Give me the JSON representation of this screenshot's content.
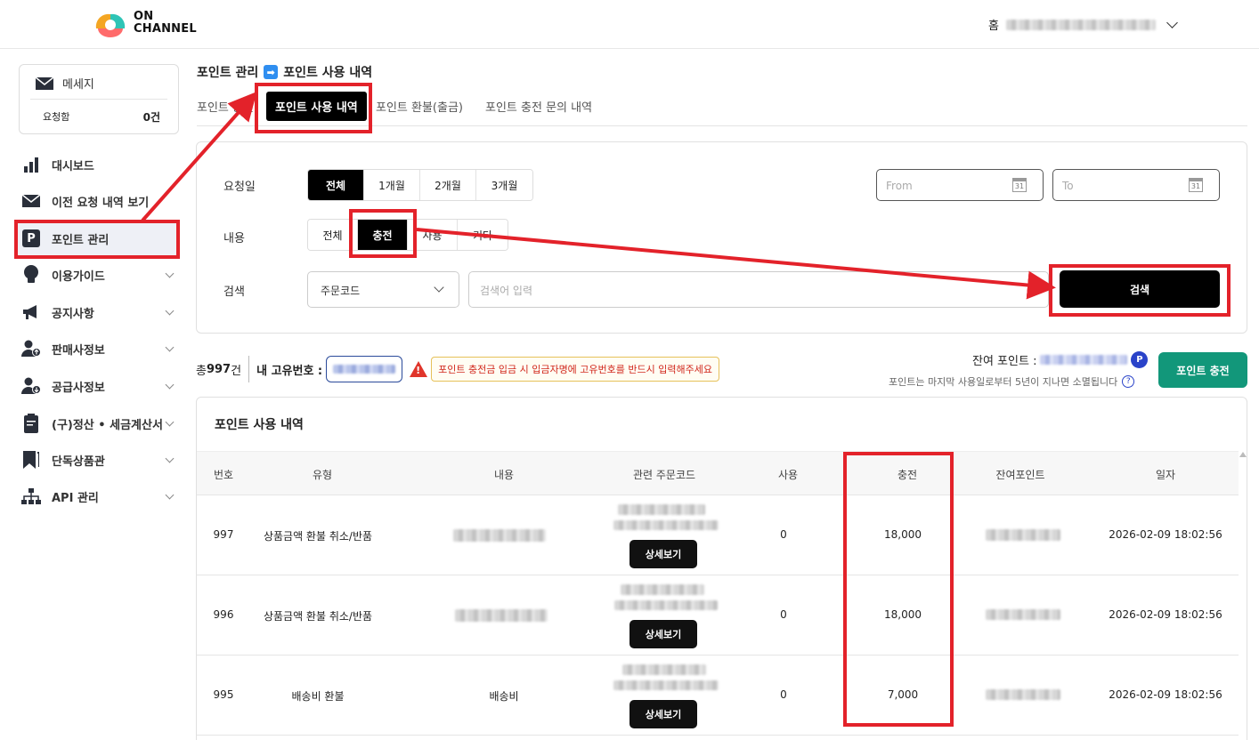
{
  "header": {
    "logo_line1": "ON",
    "logo_line2": "CHANNEL",
    "home_label": "홈"
  },
  "sidebar": {
    "message": {
      "title": "메세지",
      "request_label": "요청함",
      "request_count": "0건"
    },
    "items": [
      {
        "label": "대시보드",
        "icon": "bar-chart-icon"
      },
      {
        "label": "이전 요청 내역 보기",
        "icon": "envelope-icon"
      },
      {
        "label": "포인트 관리",
        "icon": "p-icon",
        "active": true
      },
      {
        "label": "이용가이드",
        "icon": "bulb-icon"
      },
      {
        "label": "공지사항",
        "icon": "megaphone-icon"
      },
      {
        "label": "판매사정보",
        "icon": "seller-icon"
      },
      {
        "label": "공급사정보",
        "icon": "supplier-icon"
      },
      {
        "label": "(구)정산 • 세금계산서",
        "icon": "clipboard-icon"
      },
      {
        "label": "단독상품관",
        "icon": "bookmark-icon"
      },
      {
        "label": "API 관리",
        "icon": "sitemap-icon"
      }
    ]
  },
  "breadcrumb": {
    "parent": "포인트 관리",
    "arrow": "➡",
    "current": "포인트 사용 내역"
  },
  "tabs": [
    "포인트 충전",
    "포인트 사용 내역",
    "포인트 환불(출금)",
    "포인트 충전 문의 내역"
  ],
  "filters": {
    "date_label": "요청일",
    "date_options": [
      "전체",
      "1개월",
      "2개월",
      "3개월"
    ],
    "from_placeholder": "From",
    "to_placeholder": "To",
    "calendar_day": "31",
    "content_label": "내용",
    "content_options": [
      "전체",
      "충전",
      "사용",
      "기타"
    ],
    "search_label": "검색",
    "search_select": "주문코드",
    "search_placeholder": "검색어 입력",
    "search_button": "검색"
  },
  "summary": {
    "total_prefix": "총 ",
    "total_count": "997",
    "total_suffix": "건",
    "uid_label": "내 고유번호 :",
    "warning": "포인트 충전금 입금 시 입금자명에 고유번호를 반드시 입력해주세요",
    "balance_label": "잔여 포인트 :",
    "p_badge": "P",
    "expire_note": "포인트는 마지막 사용일로부터 5년이 지나면 소멸됩니다",
    "help": "?",
    "charge_button": "포인트 충전"
  },
  "table": {
    "title": "포인트 사용 내역",
    "headers": [
      "번호",
      "유형",
      "내용",
      "관련 주문코드",
      "사용",
      "충전",
      "잔여포인트",
      "일자"
    ],
    "detail_button": "상세보기",
    "rows": [
      {
        "no": "997",
        "type": "상품금액 환불 취소/반품",
        "content": "",
        "use": "0",
        "charge": "18,000",
        "date": "2026-02-09 18:02:56"
      },
      {
        "no": "996",
        "type": "상품금액 환불 취소/반품",
        "content": "",
        "use": "0",
        "charge": "18,000",
        "date": "2026-02-09 18:02:56"
      },
      {
        "no": "995",
        "type": "배송비 환불",
        "content": "배송비",
        "use": "0",
        "charge": "7,000",
        "date": "2026-02-09 18:02:56"
      }
    ]
  },
  "colors": {
    "accent_red": "#e3222a",
    "charge_green": "#12977a",
    "point_blue": "#2a43c9"
  }
}
